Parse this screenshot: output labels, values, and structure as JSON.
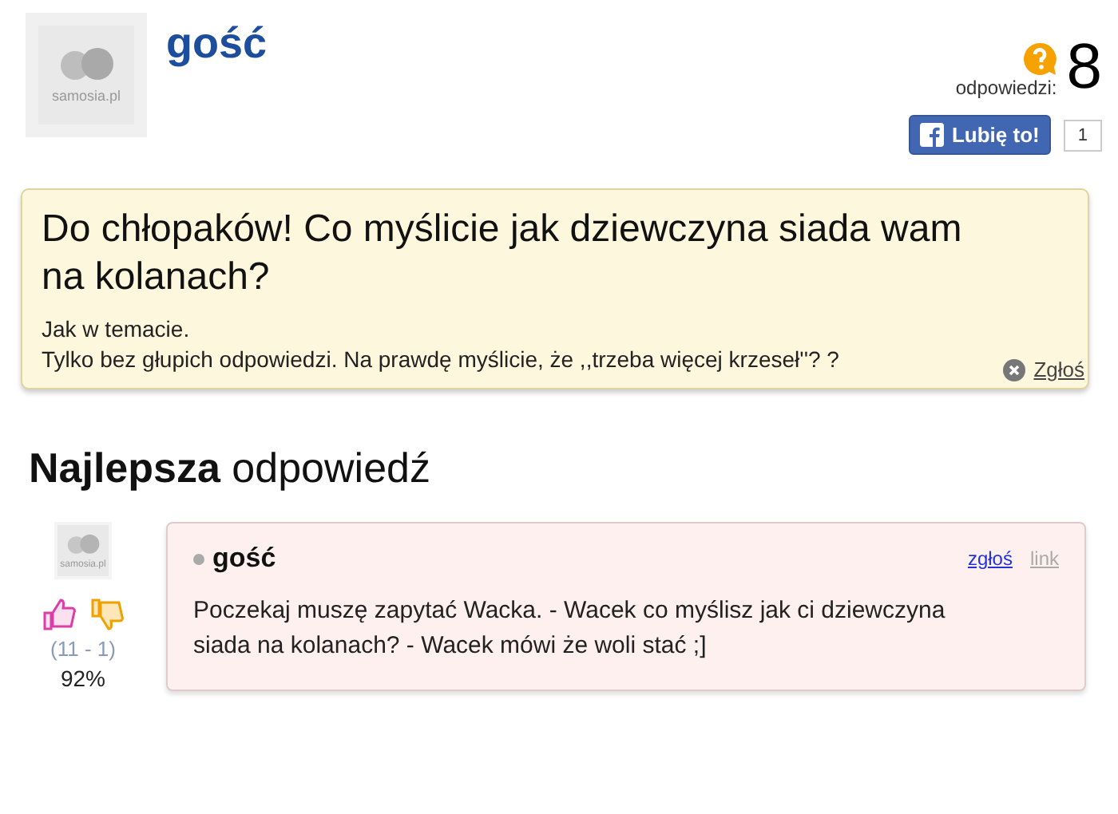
{
  "question": {
    "avatar_logo": "samosia.pl",
    "author": "gość",
    "answers_label": "odpowiedzi:",
    "answers_count": "8",
    "like_button": "Lubię to!",
    "like_count": "1",
    "title": "Do chłopaków! Co myślicie jak dziewczyna siada wam na kolanach?",
    "body": [
      "Jak w temacie.",
      "Tylko bez głupich odpowiedzi. Na prawdę myślicie, że ,,trzeba więcej krzeseł''? ?"
    ],
    "report_link": "Zgłoś"
  },
  "best_answer": {
    "heading_bold": "Najlepsza",
    "heading_rest": "odpowiedź",
    "avatar_logo": "samosia.pl",
    "votes": "(11 - 1)",
    "percent": "92%",
    "author": "gość",
    "report_link": "zgłoś",
    "link": "link",
    "text": "Poczekaj muszę zapytać Wacka. - Wacek co myślisz jak ci dziewczyna siada na kolanach? - Wacek mówi że woli stać ;]"
  }
}
